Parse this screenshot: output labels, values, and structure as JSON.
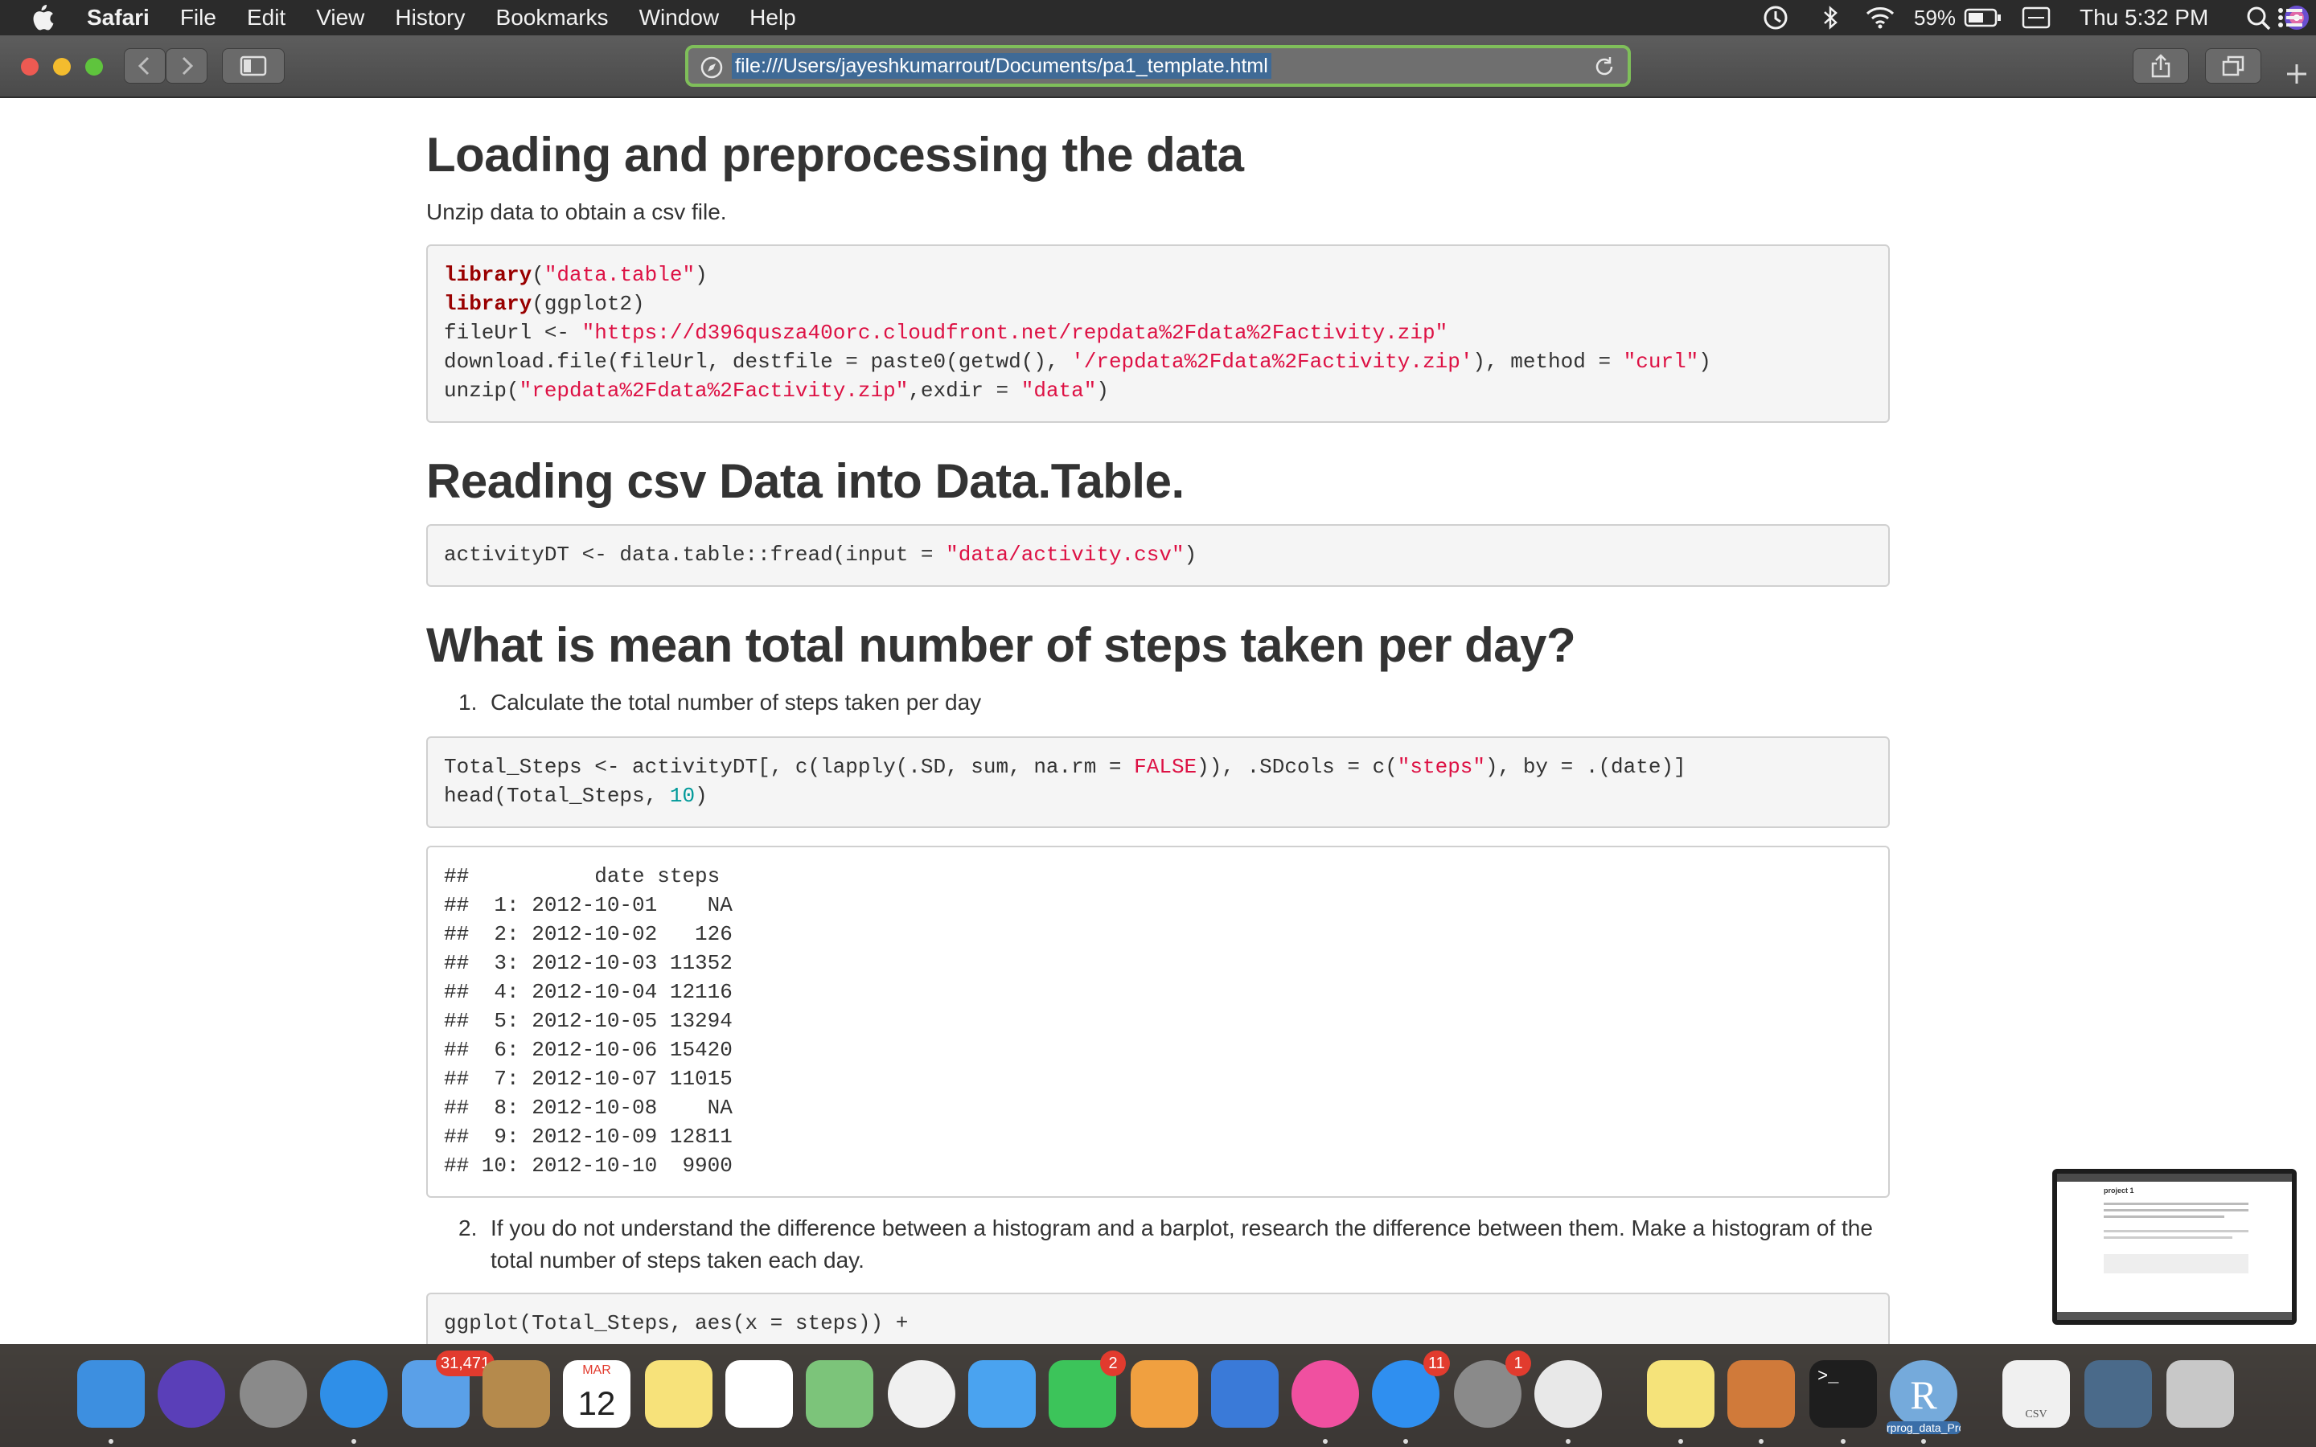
{
  "menubar": {
    "app_name": "Safari",
    "items": [
      "File",
      "Edit",
      "View",
      "History",
      "Bookmarks",
      "Window",
      "Help"
    ],
    "battery": "59%",
    "clock": "Thu 5:32 PM"
  },
  "toolbar": {
    "url": "file:///Users/jayeshkumarrout/Documents/pa1_template.html"
  },
  "page": {
    "section1": {
      "heading": "Loading and preprocessing the data",
      "intro": "Unzip data to obtain a csv file.",
      "code": [
        [
          [
            "kw",
            "library"
          ],
          [
            "t",
            "("
          ],
          [
            "str",
            "\"data.table\""
          ],
          [
            "t",
            ")"
          ]
        ],
        [
          [
            "kw",
            "library"
          ],
          [
            "t",
            "(ggplot2)"
          ]
        ],
        [
          [
            "t",
            "fileUrl <- "
          ],
          [
            "str",
            "\"https://d396qusza40orc.cloudfront.net/repdata%2Fdata%2Factivity.zip\""
          ]
        ],
        [
          [
            "t",
            "download.file(fileUrl, destfile = paste0(getwd(), "
          ],
          [
            "str",
            "'/repdata%2Fdata%2Factivity.zip'"
          ],
          [
            "t",
            "), method = "
          ],
          [
            "str",
            "\"curl\""
          ],
          [
            "t",
            ")"
          ]
        ],
        [
          [
            "t",
            "unzip("
          ],
          [
            "str",
            "\"repdata%2Fdata%2Factivity.zip\""
          ],
          [
            "t",
            ",exdir = "
          ],
          [
            "str",
            "\"data\""
          ],
          [
            "t",
            ")"
          ]
        ]
      ]
    },
    "section2": {
      "heading": "Reading csv Data into Data.Table.",
      "code": [
        [
          [
            "t",
            "activityDT <- data.table::fread(input = "
          ],
          [
            "str",
            "\"data/activity.csv\""
          ],
          [
            "t",
            ")"
          ]
        ]
      ]
    },
    "section3": {
      "heading": "What is mean total number of steps taken per day?",
      "step1_num": "1.",
      "step1": "Calculate the total number of steps taken per day",
      "code": [
        [
          [
            "t",
            "Total_Steps <- activityDT[, c(lapply(.SD, sum, na.rm = "
          ],
          [
            "str",
            "FALSE"
          ],
          [
            "t",
            ")), .SDcols = c("
          ],
          [
            "str",
            "\"steps\""
          ],
          [
            "t",
            "), by = .(date)]"
          ]
        ],
        [
          [
            "t",
            "head(Total_Steps, "
          ],
          [
            "num",
            "10"
          ],
          [
            "t",
            ")"
          ]
        ]
      ],
      "output": [
        "##          date steps",
        "##  1: 2012-10-01    NA",
        "##  2: 2012-10-02   126",
        "##  3: 2012-10-03 11352",
        "##  4: 2012-10-04 12116",
        "##  5: 2012-10-05 13294",
        "##  6: 2012-10-06 15420",
        "##  7: 2012-10-07 11015",
        "##  8: 2012-10-08    NA",
        "##  9: 2012-10-09 12811",
        "## 10: 2012-10-10  9900"
      ],
      "step2_num": "2.",
      "step2_line1": "If you do not understand the difference between a histogram and a barplot, research the difference between them. Make a histogram of the",
      "step2_line2": "total number of steps taken each day.",
      "code2": [
        [
          [
            "t",
            "ggplot(Total_Steps, aes(x = steps)) +"
          ]
        ]
      ]
    }
  },
  "dock": {
    "items": [
      {
        "name": "finder-icon",
        "color": "#3d8fe0"
      },
      {
        "name": "siri-icon",
        "color": "#5a3fb8"
      },
      {
        "name": "launchpad-icon",
        "color": "#8a8a8a"
      },
      {
        "name": "safari-icon",
        "color": "#2f8fe8"
      },
      {
        "name": "mail-icon",
        "color": "#5aa0e8",
        "badge": "31,471"
      },
      {
        "name": "contacts-icon",
        "color": "#b58a4c"
      },
      {
        "name": "calendar-icon",
        "color": "#ffffff",
        "label_top": "MAR",
        "label": "12"
      },
      {
        "name": "notes-icon",
        "color": "#f7e27a"
      },
      {
        "name": "reminders-icon",
        "color": "#ffffff"
      },
      {
        "name": "maps-icon",
        "color": "#7cc47a"
      },
      {
        "name": "photos-icon",
        "color": "#f0f0f0"
      },
      {
        "name": "messages-icon",
        "color": "#4aa3f0"
      },
      {
        "name": "facetime-icon",
        "color": "#3cc45a",
        "badge": "2"
      },
      {
        "name": "pages-icon",
        "color": "#f0a040"
      },
      {
        "name": "keynote-icon",
        "color": "#3a7ad8"
      },
      {
        "name": "itunes-icon",
        "color": "#f050a0"
      },
      {
        "name": "app-store-icon",
        "color": "#2f8ff0",
        "badge": "11"
      },
      {
        "name": "system-preferences-icon",
        "color": "#8a8a8a",
        "badge": "1"
      },
      {
        "name": "chrome-icon",
        "color": "#e8e8e8"
      },
      {
        "name": "stickies-icon",
        "color": "#f5e37a"
      },
      {
        "name": "calculator-icon",
        "color": "#d07a3a"
      },
      {
        "name": "terminal-icon",
        "color": "#1e1e1e"
      },
      {
        "name": "rstudio-icon",
        "color": "#75aadb",
        "label": "R"
      },
      {
        "name": "csv-document-icon",
        "color": "#f0f0f0",
        "label": "CSV"
      },
      {
        "name": "downloads-stack-icon",
        "color": "#4a6a8a"
      },
      {
        "name": "trash-icon",
        "color": "#c8c8c8"
      }
    ],
    "rstudio_caption": "rprog_data_Pro"
  },
  "thumbnail": {
    "title": "project 1"
  }
}
